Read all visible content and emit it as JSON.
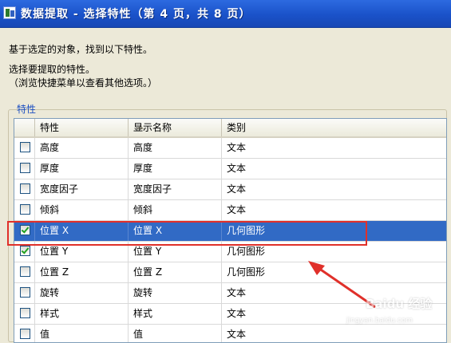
{
  "window": {
    "title": "数据提取 - 选择特性（第 4 页，共 8 页）"
  },
  "description": {
    "line1": "基于选定的对象，找到以下特性。",
    "line2": "选择要提取的特性。",
    "line3": "（浏览快捷菜单以查看其他选项。）"
  },
  "group": {
    "label": "特性"
  },
  "table": {
    "columns": [
      {
        "label": "特性"
      },
      {
        "label": "显示名称"
      },
      {
        "label": "类别"
      }
    ],
    "rows": [
      {
        "checked": false,
        "property": "高度",
        "display": "高度",
        "category": "文本"
      },
      {
        "checked": false,
        "property": "厚度",
        "display": "厚度",
        "category": "文本"
      },
      {
        "checked": false,
        "property": "宽度因子",
        "display": "宽度因子",
        "category": "文本"
      },
      {
        "checked": false,
        "property": "倾斜",
        "display": "倾斜",
        "category": "文本"
      },
      {
        "checked": true,
        "selected": true,
        "property": "位置 X",
        "display": "位置 X",
        "category": "几何图形"
      },
      {
        "checked": true,
        "property": "位置 Y",
        "display": "位置 Y",
        "category": "几何图形"
      },
      {
        "checked": false,
        "property": "位置 Z",
        "display": "位置 Z",
        "category": "几何图形"
      },
      {
        "checked": false,
        "property": "旋转",
        "display": "旋转",
        "category": "文本"
      },
      {
        "checked": false,
        "property": "样式",
        "display": "样式",
        "category": "文本"
      },
      {
        "checked": false,
        "property": "值",
        "display": "值",
        "category": "文本"
      }
    ]
  },
  "annotation": {
    "color": "#e0302a"
  },
  "watermark": {
    "text": "Baidu 经验",
    "url": "jingyan.baidu.com"
  }
}
